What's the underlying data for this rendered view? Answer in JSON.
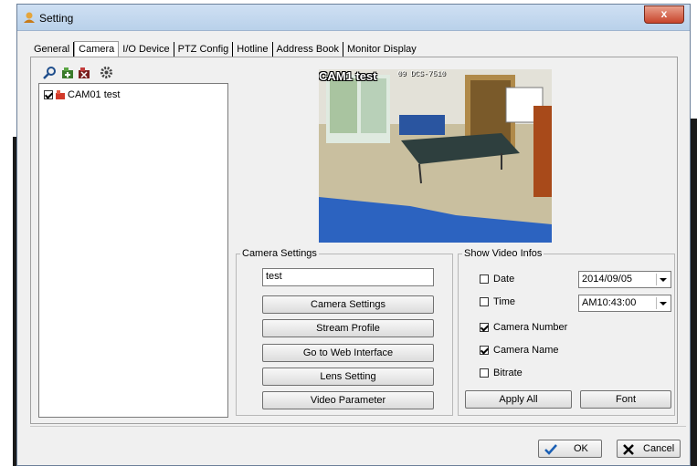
{
  "window": {
    "title": "Setting",
    "close_label": "x"
  },
  "tabs": [
    {
      "label": "General"
    },
    {
      "label": "Camera"
    },
    {
      "label": "I/O Device"
    },
    {
      "label": "PTZ Config"
    },
    {
      "label": "Hotline"
    },
    {
      "label": "Address Book"
    },
    {
      "label": "Monitor Display"
    }
  ],
  "active_tab": "Camera",
  "toolbar": {
    "icons": [
      "search-icon",
      "add-camera-icon",
      "delete-camera-icon",
      "settings-icon"
    ]
  },
  "tree": {
    "items": [
      {
        "label": "CAM01 test",
        "checked": true
      }
    ]
  },
  "preview": {
    "caption": "CAM1 test",
    "stamp": "09 DCS-7510"
  },
  "camera_settings": {
    "legend": "Camera Settings",
    "name_value": "test",
    "buttons": [
      "Camera Settings",
      "Stream Profile",
      "Go to Web Interface",
      "Lens Setting",
      "Video Parameter"
    ]
  },
  "video_infos": {
    "legend": "Show Video Infos",
    "options": [
      {
        "label": "Date",
        "checked": false
      },
      {
        "label": "Time",
        "checked": false
      },
      {
        "label": "Camera Number",
        "checked": true
      },
      {
        "label": "Camera Name",
        "checked": true
      },
      {
        "label": "Bitrate",
        "checked": false
      }
    ],
    "date_value": "2014/09/05",
    "time_value": "AM10:43:00",
    "apply_all_label": "Apply All",
    "font_label": "Font"
  },
  "footer": {
    "ok_label": "OK",
    "cancel_label": "Cancel"
  },
  "colors": {
    "titlebar": "#c5dbf2",
    "close": "#c7442b",
    "ok_check": "#1a5fb4"
  }
}
